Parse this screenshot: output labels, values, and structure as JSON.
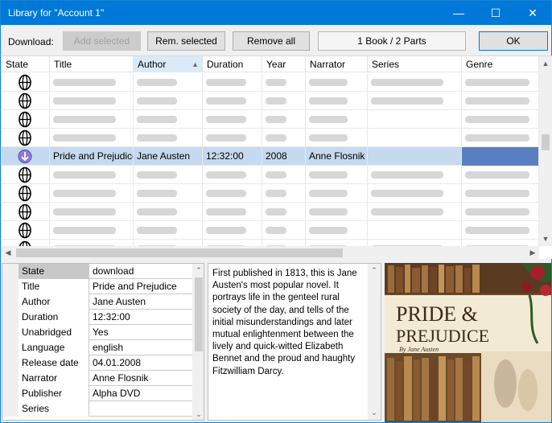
{
  "window": {
    "title": "Library for \"Account 1\"",
    "minimize_icon": "minimize-icon",
    "maximize_icon": "maximize-icon",
    "close_icon": "close-icon"
  },
  "toolbar": {
    "download_label": "Download:",
    "add_selected": "Add selected",
    "rem_selected": "Rem. selected",
    "remove_all": "Remove all",
    "summary": "1 Book / 2 Parts",
    "ok": "OK"
  },
  "grid": {
    "columns": [
      "State",
      "Title",
      "Author",
      "Duration",
      "Year",
      "Narrator",
      "Series",
      "Genre"
    ],
    "sorted_column": "Author",
    "selected_row": {
      "state_icon": "download-arrow-icon",
      "title": "Pride and Prejudice",
      "author": "Jane Austen",
      "duration": "12:32:00",
      "year": "2008",
      "narrator": "Anne Flosnik",
      "series": "",
      "genre": ""
    }
  },
  "properties": {
    "rows": [
      {
        "key": "State",
        "value": "download"
      },
      {
        "key": "Title",
        "value": "Pride and Prejudice"
      },
      {
        "key": "Author",
        "value": "Jane Austen"
      },
      {
        "key": "Duration",
        "value": "12:32:00"
      },
      {
        "key": "Unabridged",
        "value": "Yes"
      },
      {
        "key": "Language",
        "value": "english"
      },
      {
        "key": "Release date",
        "value": "04.01.2008"
      },
      {
        "key": "Narrator",
        "value": "Anne Flosnik"
      },
      {
        "key": "Publisher",
        "value": "Alpha DVD"
      },
      {
        "key": "Series",
        "value": ""
      }
    ]
  },
  "description": "First published in 1813, this is Jane Austen's most popular novel. It portrays life in the genteel rural society of the day, and tells of the initial misunderstandings and later mutual enlightenment between the lively and quick-witted Elizabeth Bennet and the proud and haughty Fitzwilliam Darcy.",
  "cover": {
    "title_line1": "PRIDE &",
    "title_line2": "PREJUDICE",
    "byline": "By Jane Austen"
  }
}
